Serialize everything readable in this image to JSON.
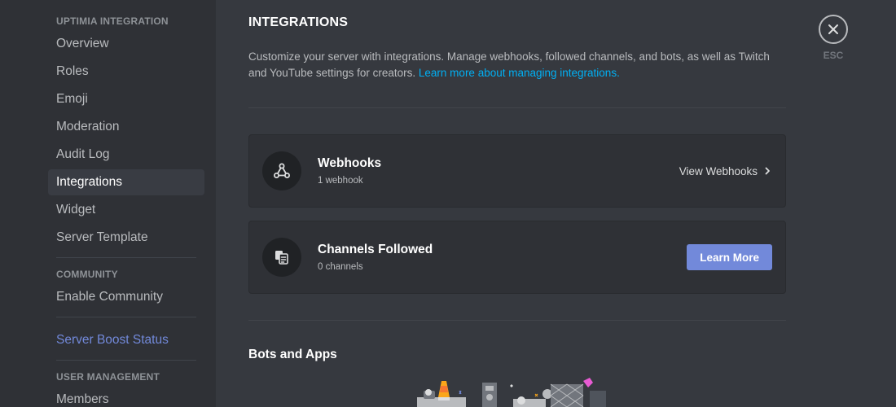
{
  "sidebar": {
    "sections": [
      {
        "header": "Uptimia Integration",
        "items": [
          {
            "label": "Overview"
          },
          {
            "label": "Roles"
          },
          {
            "label": "Emoji"
          },
          {
            "label": "Moderation"
          },
          {
            "label": "Audit Log"
          },
          {
            "label": "Integrations",
            "active": true
          },
          {
            "label": "Widget"
          },
          {
            "label": "Server Template"
          }
        ]
      },
      {
        "header": "Community",
        "items": [
          {
            "label": "Enable Community"
          }
        ]
      },
      {
        "header": "",
        "items": [
          {
            "label": "Server Boost Status",
            "accent": true
          }
        ]
      },
      {
        "header": "User Management",
        "items": [
          {
            "label": "Members"
          }
        ]
      }
    ]
  },
  "main": {
    "title": "Integrations",
    "description": "Customize your server with integrations. Manage webhooks, followed channels, and bots, as well as Twitch and YouTube settings for creators.",
    "description_link": "Learn more about managing integrations.",
    "webhooks": {
      "icon": "webhook-icon",
      "title": "Webhooks",
      "count": "1 webhook",
      "action_label": "View Webhooks"
    },
    "channels_followed": {
      "icon": "channel-follow-icon",
      "title": "Channels Followed",
      "count": "0 channels",
      "action_label": "Learn More"
    },
    "bots_heading": "Bots and Apps"
  },
  "close": {
    "label": "ESC",
    "icon": "close-icon"
  },
  "colors": {
    "sidebar_bg": "#2f3136",
    "content_bg": "#36393f",
    "accent": "#7289da",
    "link": "#00b0f4"
  }
}
